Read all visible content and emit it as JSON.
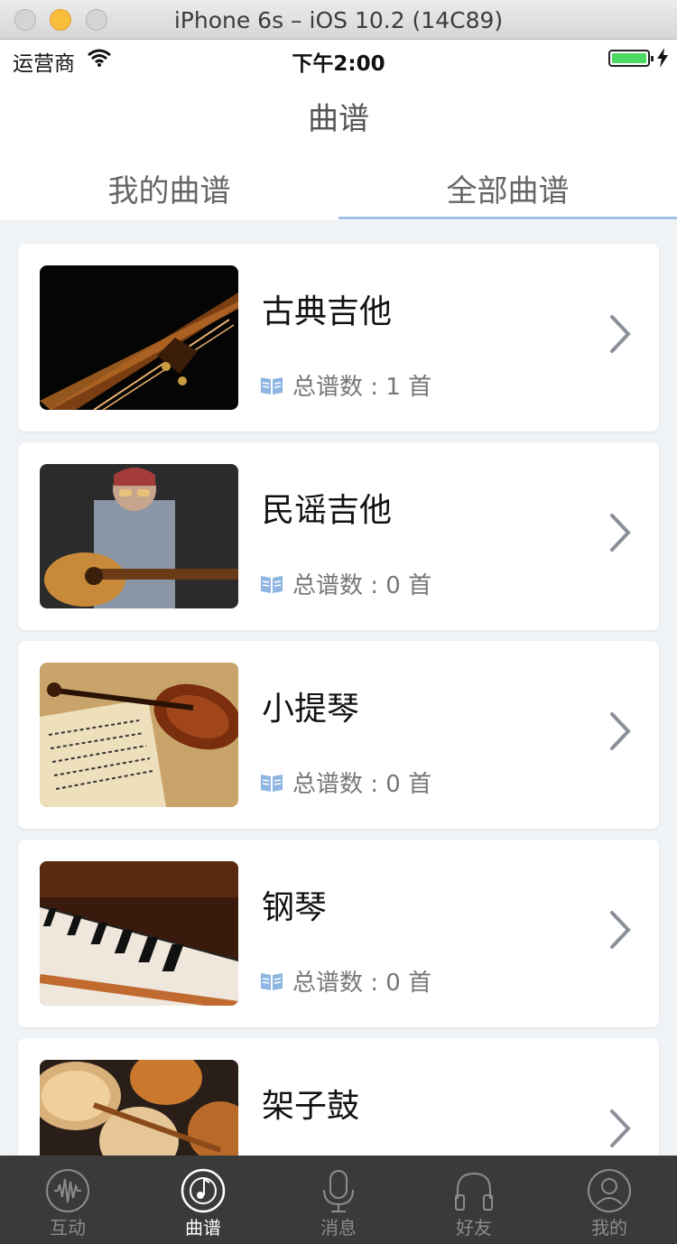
{
  "window": {
    "title": "iPhone 6s – iOS 10.2 (14C89)"
  },
  "status_bar": {
    "carrier": "运营商",
    "time": "下午2:00"
  },
  "header": {
    "title": "曲谱"
  },
  "tabs": [
    {
      "label": "我的曲谱"
    },
    {
      "label": "全部曲谱"
    }
  ],
  "active_tab": "全部曲谱",
  "cards": [
    {
      "title": "古典吉他",
      "count": "总谱数 : 1 首",
      "image": "classical-guitar-photo"
    },
    {
      "title": "民谣吉他",
      "count": "总谱数 : 0 首",
      "image": "folk-guitar-photo"
    },
    {
      "title": "小提琴",
      "count": "总谱数 : 0 首",
      "image": "violin-photo"
    },
    {
      "title": "钢琴",
      "count": "总谱数 : 0 首",
      "image": "piano-photo"
    },
    {
      "title": "架子鼓",
      "count": "",
      "image": "drum-kit-photo"
    }
  ],
  "tabbar": [
    {
      "label": "互动",
      "icon": "waveform-icon"
    },
    {
      "label": "曲谱",
      "icon": "music-disc-icon"
    },
    {
      "label": "消息",
      "icon": "microphone-icon"
    },
    {
      "label": "好友",
      "icon": "headphones-icon"
    },
    {
      "label": "我的",
      "icon": "person-icon"
    }
  ],
  "colors": {
    "accent": "#9cc0e6",
    "tabbar_bg": "#3a3a3a",
    "battery": "#4cd964",
    "book_icon": "#8fb6e2"
  }
}
